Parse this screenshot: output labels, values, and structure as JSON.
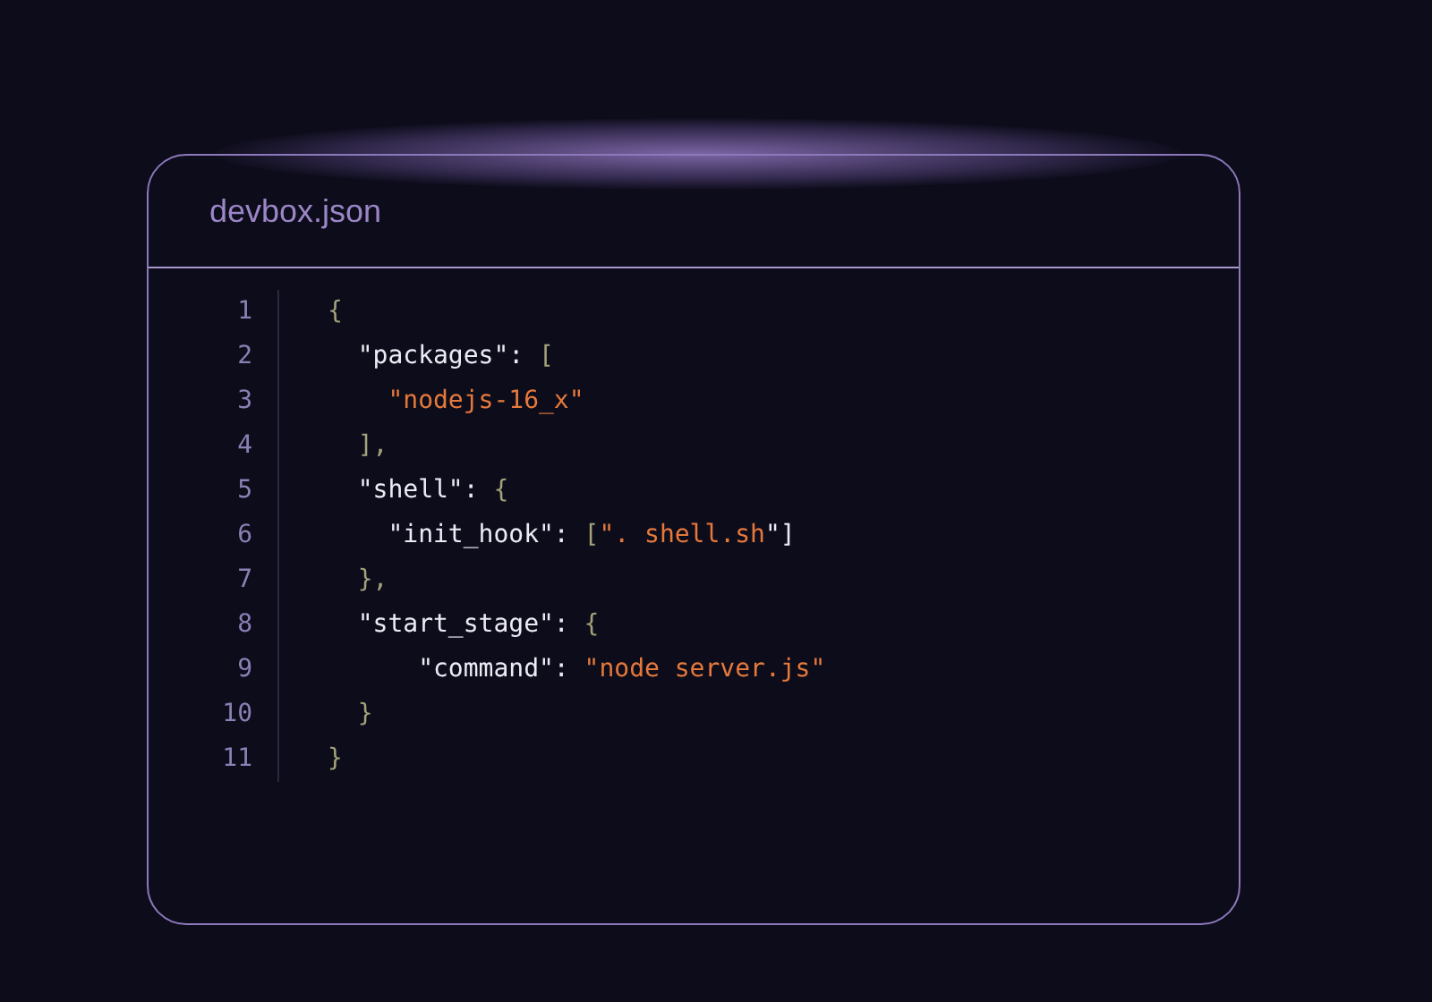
{
  "card": {
    "title": "devbox.json",
    "lines": [
      {
        "number": "1",
        "tokens": [
          {
            "kind": "punct",
            "text": "{"
          }
        ]
      },
      {
        "number": "2",
        "tokens": [
          {
            "kind": "key",
            "text": "  \"packages\": "
          },
          {
            "kind": "punct",
            "text": "["
          }
        ]
      },
      {
        "number": "3",
        "tokens": [
          {
            "kind": "string",
            "text": "    \"nodejs-16_x\""
          }
        ]
      },
      {
        "number": "4",
        "tokens": [
          {
            "kind": "punct",
            "text": "  ],"
          }
        ]
      },
      {
        "number": "5",
        "tokens": [
          {
            "kind": "key",
            "text": "  \"shell\": "
          },
          {
            "kind": "punct",
            "text": "{"
          }
        ]
      },
      {
        "number": "6",
        "tokens": [
          {
            "kind": "key",
            "text": "    \"init_hook\": "
          },
          {
            "kind": "punct",
            "text": "["
          },
          {
            "kind": "string",
            "text": "\". shell.sh"
          },
          {
            "kind": "key",
            "text": "\"]"
          }
        ]
      },
      {
        "number": "7",
        "tokens": [
          {
            "kind": "punct",
            "text": "  },"
          }
        ]
      },
      {
        "number": "8",
        "tokens": [
          {
            "kind": "key",
            "text": "  \"start_stage\": "
          },
          {
            "kind": "punct",
            "text": "{"
          }
        ]
      },
      {
        "number": "9",
        "tokens": [
          {
            "kind": "key",
            "text": "      \"command\": "
          },
          {
            "kind": "string",
            "text": "\"node server.js\""
          }
        ]
      },
      {
        "number": "10",
        "tokens": [
          {
            "kind": "punct",
            "text": "  }"
          }
        ]
      },
      {
        "number": "11",
        "tokens": [
          {
            "kind": "punct",
            "text": "}"
          }
        ]
      }
    ]
  }
}
